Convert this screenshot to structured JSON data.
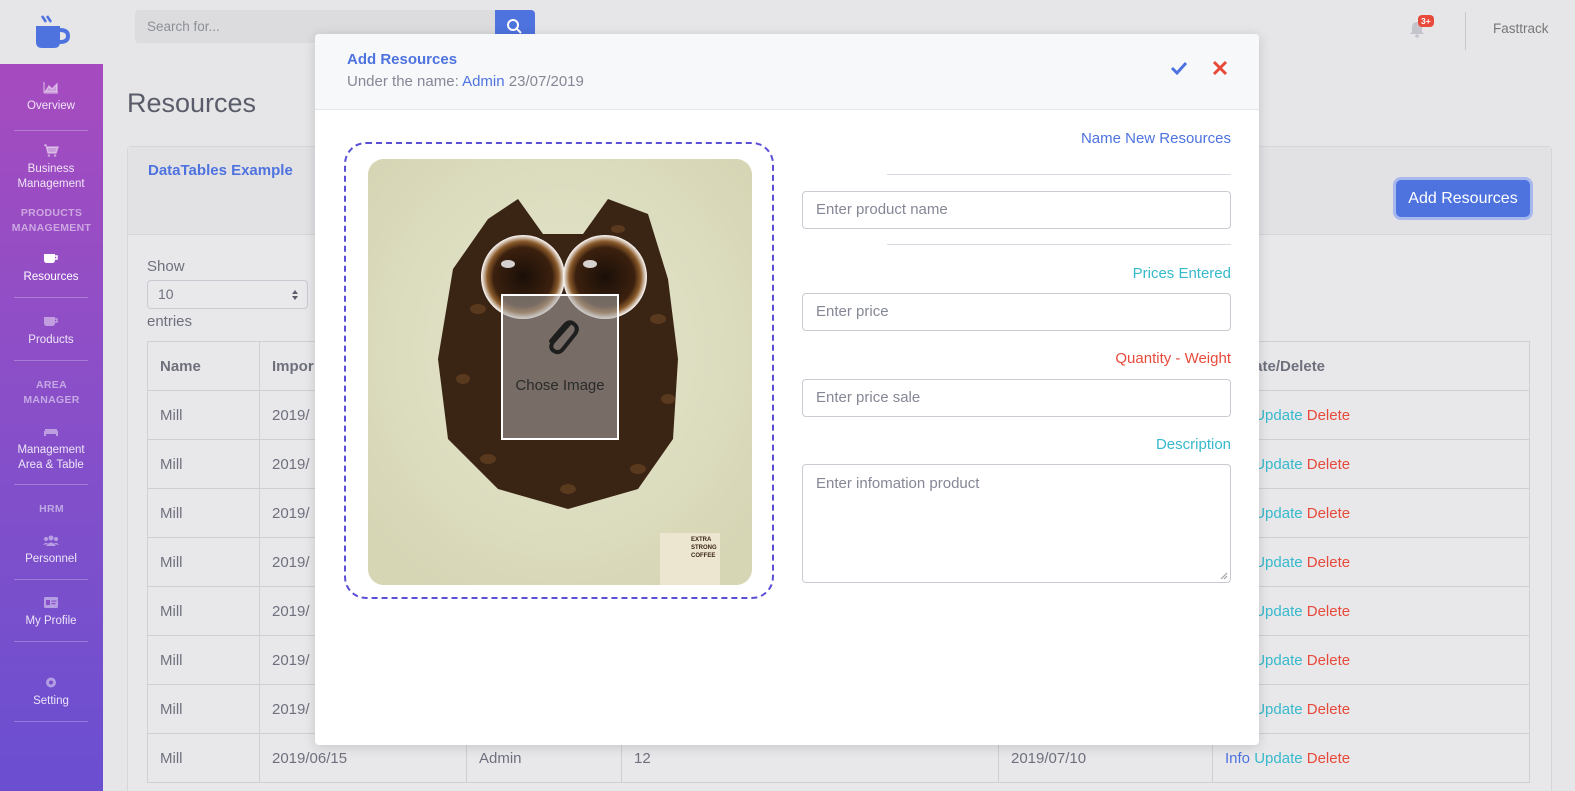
{
  "topbar": {
    "search_placeholder": "Search for...",
    "notification_badge": "3+",
    "username": "Fasttrack"
  },
  "sidebar": {
    "items": [
      {
        "label": "Overview",
        "icon": "chart-area-icon"
      },
      {
        "label": "Business Management",
        "icon": "shopping-cart-icon"
      },
      {
        "label": "Resources",
        "icon": "coffee-icon"
      },
      {
        "label": "Products",
        "icon": "coffee-icon"
      },
      {
        "label": "Management Area & Table",
        "icon": "couch-icon"
      },
      {
        "label": "Personnel",
        "icon": "users-icon"
      },
      {
        "label": "My Profile",
        "icon": "id-card-icon"
      },
      {
        "label": "Setting",
        "icon": "cog-icon"
      }
    ],
    "headings": {
      "products": "PRODUCTS MANAGEMENT",
      "area": "AREA MANAGER",
      "hrm": "HRM"
    }
  },
  "page": {
    "title": "Resources",
    "card_title": "DataTables Example",
    "add_button": "Add Resources",
    "show_label": "Show",
    "show_value": "10",
    "entries_label": "entries"
  },
  "table": {
    "headers": [
      "Name",
      "Impor",
      "",
      "",
      "",
      "Update/Delete"
    ],
    "rows": [
      {
        "name": "Mill",
        "date": "2019/",
        "by": "",
        "qty": "",
        "date2": ""
      },
      {
        "name": "Mill",
        "date": "2019/",
        "by": "",
        "qty": "",
        "date2": ""
      },
      {
        "name": "Mill",
        "date": "2019/",
        "by": "",
        "qty": "",
        "date2": ""
      },
      {
        "name": "Mill",
        "date": "2019/",
        "by": "",
        "qty": "",
        "date2": ""
      },
      {
        "name": "Mill",
        "date": "2019/",
        "by": "",
        "qty": "",
        "date2": ""
      },
      {
        "name": "Mill",
        "date": "2019/",
        "by": "",
        "qty": "",
        "date2": ""
      },
      {
        "name": "Mill",
        "date": "2019/",
        "by": "",
        "qty": "",
        "date2": ""
      },
      {
        "name": "Mill",
        "date": "2019/06/15",
        "by": "Admin",
        "qty": "12",
        "date2": "2019/07/10"
      }
    ],
    "info_label": "Info",
    "update_label": "Update",
    "delete_label": "Delete"
  },
  "modal": {
    "title": "Add Resources",
    "subtitle_prefix": "Under the name:",
    "subtitle_user": "Admin",
    "subtitle_date": "23/07/2019",
    "chose_image": "Chose Image",
    "packet_text": "EXTRA STRONG COFFEE",
    "fields": {
      "name_label": "Name New Resources",
      "name_placeholder": "Enter product name",
      "price_label": "Prices Entered",
      "price_placeholder": "Enter price",
      "qty_label": "Quantity - Weight",
      "qty_placeholder": "Enter price sale",
      "desc_label": "Description",
      "desc_placeholder": "Enter infomation product"
    }
  },
  "colors": {
    "primary": "#4e73df",
    "info": "#36b9cc",
    "danger": "#e74a3b",
    "sidebar_top": "#a64bbf",
    "sidebar_bottom": "#6a4fd0"
  }
}
